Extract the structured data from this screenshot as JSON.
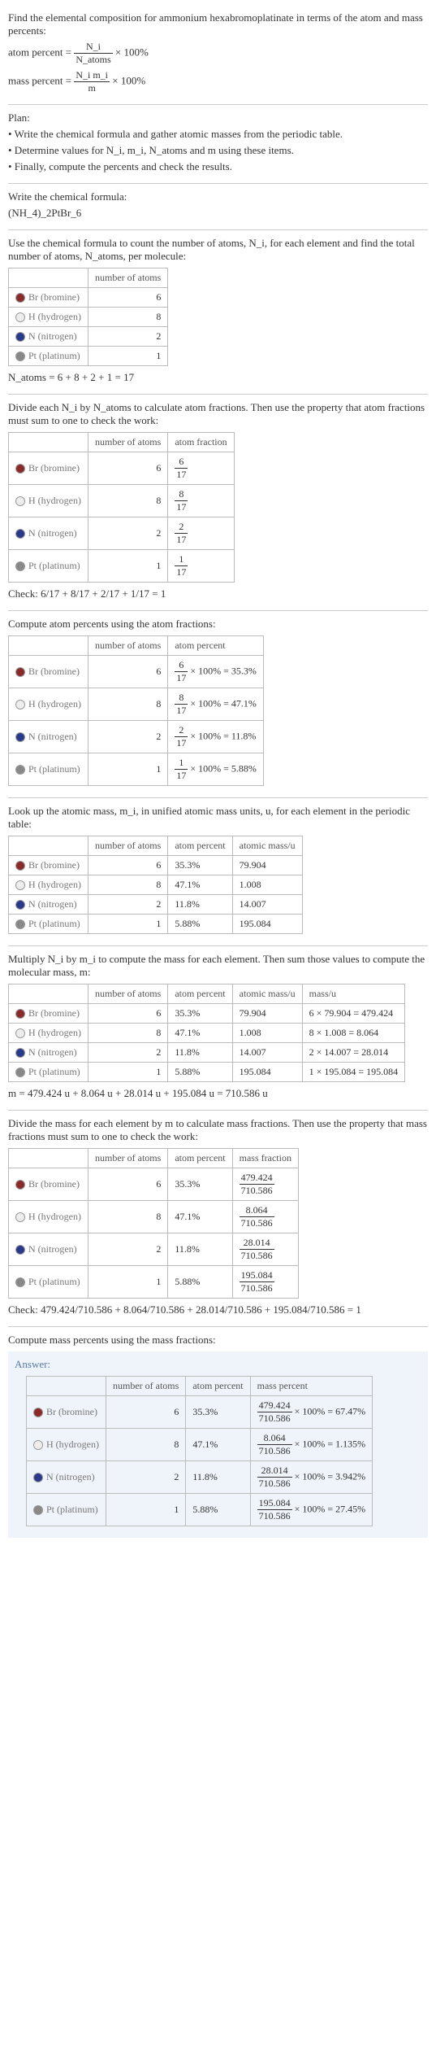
{
  "intro": {
    "line1": "Find the elemental composition for ammonium hexabromoplatinate in terms of the atom and mass percents:",
    "atom_label": "atom percent =",
    "atom_frac_num": "N_i",
    "atom_frac_den": "N_atoms",
    "times100": "× 100%",
    "mass_label": "mass percent =",
    "mass_frac_num": "N_i m_i",
    "mass_frac_den": "m"
  },
  "plan": {
    "heading": "Plan:",
    "b1": "• Write the chemical formula and gather atomic masses from the periodic table.",
    "b2": "• Determine values for N_i, m_i, N_atoms and m using these items.",
    "b3": "• Finally, compute the percents and check the results."
  },
  "formula": {
    "heading": "Write the chemical formula:",
    "value": "(NH_4)_2PtBr_6"
  },
  "count": {
    "heading": "Use the chemical formula to count the number of atoms, N_i, for each element and find the total number of atoms, N_atoms, per molecule:",
    "h_atoms": "number of atoms",
    "rows": [
      {
        "name": "Br (bromine)",
        "cls": "br",
        "n": "6"
      },
      {
        "name": "H (hydrogen)",
        "cls": "h",
        "n": "8"
      },
      {
        "name": "N (nitrogen)",
        "cls": "n",
        "n": "2"
      },
      {
        "name": "Pt (platinum)",
        "cls": "pt",
        "n": "1"
      }
    ],
    "sum": "N_atoms = 6 + 8 + 2 + 1 = 17"
  },
  "atomfrac": {
    "heading": "Divide each N_i by N_atoms to calculate atom fractions. Then use the property that atom fractions must sum to one to check the work:",
    "h_atoms": "number of atoms",
    "h_frac": "atom fraction",
    "rows": [
      {
        "name": "Br (bromine)",
        "cls": "br",
        "n": "6",
        "frac_num": "6",
        "frac_den": "17"
      },
      {
        "name": "H (hydrogen)",
        "cls": "h",
        "n": "8",
        "frac_num": "8",
        "frac_den": "17"
      },
      {
        "name": "N (nitrogen)",
        "cls": "n",
        "n": "2",
        "frac_num": "2",
        "frac_den": "17"
      },
      {
        "name": "Pt (platinum)",
        "cls": "pt",
        "n": "1",
        "frac_num": "1",
        "frac_den": "17"
      }
    ],
    "check_label": "Check:",
    "check": " 6/17 + 8/17 + 2/17 + 1/17 = 1"
  },
  "atompct": {
    "heading": "Compute atom percents using the atom fractions:",
    "h_atoms": "number of atoms",
    "h_pct": "atom percent",
    "rows": [
      {
        "name": "Br (bromine)",
        "cls": "br",
        "n": "6",
        "frac_num": "6",
        "frac_den": "17",
        "pct": "× 100% = 35.3%"
      },
      {
        "name": "H (hydrogen)",
        "cls": "h",
        "n": "8",
        "frac_num": "8",
        "frac_den": "17",
        "pct": "× 100% = 47.1%"
      },
      {
        "name": "N (nitrogen)",
        "cls": "n",
        "n": "2",
        "frac_num": "2",
        "frac_den": "17",
        "pct": "× 100% = 11.8%"
      },
      {
        "name": "Pt (platinum)",
        "cls": "pt",
        "n": "1",
        "frac_num": "1",
        "frac_den": "17",
        "pct": "× 100% = 5.88%"
      }
    ]
  },
  "atomic": {
    "heading": "Look up the atomic mass, m_i, in unified atomic mass units, u, for each element in the periodic table:",
    "h_atoms": "number of atoms",
    "h_pct": "atom percent",
    "h_mass": "atomic mass/u",
    "rows": [
      {
        "name": "Br (bromine)",
        "cls": "br",
        "n": "6",
        "pct": "35.3%",
        "mass": "79.904"
      },
      {
        "name": "H (hydrogen)",
        "cls": "h",
        "n": "8",
        "pct": "47.1%",
        "mass": "1.008"
      },
      {
        "name": "N (nitrogen)",
        "cls": "n",
        "n": "2",
        "pct": "11.8%",
        "mass": "14.007"
      },
      {
        "name": "Pt (platinum)",
        "cls": "pt",
        "n": "1",
        "pct": "5.88%",
        "mass": "195.084"
      }
    ]
  },
  "massu": {
    "heading": "Multiply N_i by m_i to compute the mass for each element. Then sum those values to compute the molecular mass, m:",
    "h_atoms": "number of atoms",
    "h_pct": "atom percent",
    "h_mass": "atomic mass/u",
    "h_massu": "mass/u",
    "rows": [
      {
        "name": "Br (bromine)",
        "cls": "br",
        "n": "6",
        "pct": "35.3%",
        "mass": "79.904",
        "mu": "6 × 79.904 = 479.424"
      },
      {
        "name": "H (hydrogen)",
        "cls": "h",
        "n": "8",
        "pct": "47.1%",
        "mass": "1.008",
        "mu": "8 × 1.008 = 8.064"
      },
      {
        "name": "N (nitrogen)",
        "cls": "n",
        "n": "2",
        "pct": "11.8%",
        "mass": "14.007",
        "mu": "2 × 14.007 = 28.014"
      },
      {
        "name": "Pt (platinum)",
        "cls": "pt",
        "n": "1",
        "pct": "5.88%",
        "mass": "195.084",
        "mu": "1 × 195.084 = 195.084"
      }
    ],
    "sum": "m = 479.424 u + 8.064 u + 28.014 u + 195.084 u = 710.586 u"
  },
  "massfrac": {
    "heading": "Divide the mass for each element by m to calculate mass fractions. Then use the property that mass fractions must sum to one to check the work:",
    "h_atoms": "number of atoms",
    "h_pct": "atom percent",
    "h_mf": "mass fraction",
    "rows": [
      {
        "name": "Br (bromine)",
        "cls": "br",
        "n": "6",
        "pct": "35.3%",
        "mf_num": "479.424",
        "mf_den": "710.586"
      },
      {
        "name": "H (hydrogen)",
        "cls": "h",
        "n": "8",
        "pct": "47.1%",
        "mf_num": "8.064",
        "mf_den": "710.586"
      },
      {
        "name": "N (nitrogen)",
        "cls": "n",
        "n": "2",
        "pct": "11.8%",
        "mf_num": "28.014",
        "mf_den": "710.586"
      },
      {
        "name": "Pt (platinum)",
        "cls": "pt",
        "n": "1",
        "pct": "5.88%",
        "mf_num": "195.084",
        "mf_den": "710.586"
      }
    ],
    "check_label": "Check:",
    "check": " 479.424/710.586 + 8.064/710.586 + 28.014/710.586 + 195.084/710.586 = 1"
  },
  "masspct": {
    "heading": "Compute mass percents using the mass fractions:"
  },
  "answer": {
    "label": "Answer:",
    "h_atoms": "number of atoms",
    "h_pct": "atom percent",
    "h_mp": "mass percent",
    "rows": [
      {
        "name": "Br (bromine)",
        "cls": "br",
        "n": "6",
        "pct": "35.3%",
        "mf_num": "479.424",
        "mf_den": "710.586",
        "mp": "× 100% = 67.47%"
      },
      {
        "name": "H (hydrogen)",
        "cls": "h",
        "n": "8",
        "pct": "47.1%",
        "mf_num": "8.064",
        "mf_den": "710.586",
        "mp": "× 100% = 1.135%"
      },
      {
        "name": "N (nitrogen)",
        "cls": "n",
        "n": "2",
        "pct": "11.8%",
        "mf_num": "28.014",
        "mf_den": "710.586",
        "mp": "× 100% = 3.942%"
      },
      {
        "name": "Pt (platinum)",
        "cls": "pt",
        "n": "1",
        "pct": "5.88%",
        "mf_num": "195.084",
        "mf_den": "710.586",
        "mp": "× 100% = 27.45%"
      }
    ]
  },
  "chart_data": {
    "type": "table",
    "title": "Elemental composition of ammonium hexabromoplatinate (NH4)2PtBr6",
    "molecular_mass_u": 710.586,
    "total_atoms": 17,
    "elements": [
      {
        "symbol": "Br",
        "name": "bromine",
        "atoms": 6,
        "atom_fraction": "6/17",
        "atom_percent": 35.3,
        "atomic_mass_u": 79.904,
        "mass_u": 479.424,
        "mass_fraction": "479.424/710.586",
        "mass_percent": 67.47
      },
      {
        "symbol": "H",
        "name": "hydrogen",
        "atoms": 8,
        "atom_fraction": "8/17",
        "atom_percent": 47.1,
        "atomic_mass_u": 1.008,
        "mass_u": 8.064,
        "mass_fraction": "8.064/710.586",
        "mass_percent": 1.135
      },
      {
        "symbol": "N",
        "name": "nitrogen",
        "atoms": 2,
        "atom_fraction": "2/17",
        "atom_percent": 11.8,
        "atomic_mass_u": 14.007,
        "mass_u": 28.014,
        "mass_fraction": "28.014/710.586",
        "mass_percent": 3.942
      },
      {
        "symbol": "Pt",
        "name": "platinum",
        "atoms": 1,
        "atom_fraction": "1/17",
        "atom_percent": 5.88,
        "atomic_mass_u": 195.084,
        "mass_u": 195.084,
        "mass_fraction": "195.084/710.586",
        "mass_percent": 27.45
      }
    ]
  }
}
